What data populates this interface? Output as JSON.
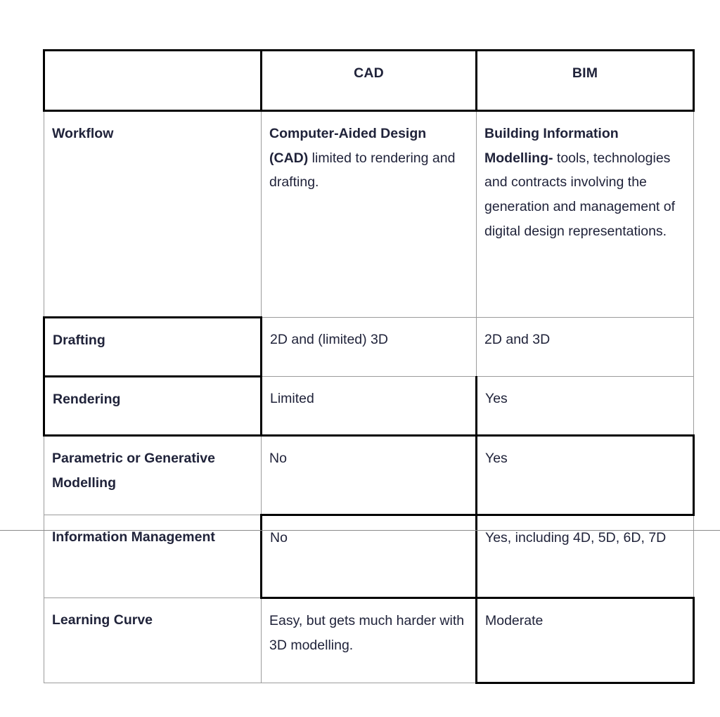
{
  "document": {
    "type": "comparison-table",
    "title_visible": false,
    "colors": {
      "header_background": "#FAE1CA",
      "text": "#20233A",
      "border_thick": "#000000",
      "border_thin": "#9B9B9B",
      "page_background": "#FFFFFF"
    },
    "page_break_rule_visible": true
  },
  "table": {
    "columns": [
      {
        "key": "criterion",
        "header": ""
      },
      {
        "key": "cad",
        "header": "CAD"
      },
      {
        "key": "bim",
        "header": "BIM"
      }
    ],
    "rows": [
      {
        "criterion": "Workflow",
        "cad_bold": "Computer-Aided Design (CAD)",
        "cad_rest": " limited to rendering and drafting.",
        "cad_full": "Computer-Aided Design (CAD) limited to rendering and drafting.",
        "bim_bold": "Building Information Modelling-",
        "bim_rest": " tools, technologies and contracts involving the generation and management of digital design representations.",
        "bim_full": "Building Information Modelling- tools, technologies and contracts involving the generation and management of digital design representations."
      },
      {
        "criterion": "Drafting",
        "cad_full": "2D and (limited) 3D",
        "bim_full": "2D and 3D"
      },
      {
        "criterion": "Rendering",
        "cad_full": "Limited",
        "bim_full": "Yes"
      },
      {
        "criterion": "Parametric or Generative Modelling",
        "cad_full": "No",
        "bim_full": "Yes"
      },
      {
        "criterion": "Information Management",
        "cad_full": "No",
        "bim_full": "Yes, including 4D, 5D, 6D, 7D"
      },
      {
        "criterion": "Learning Curve",
        "cad_full": "Easy, but gets much harder with 3D modelling.",
        "bim_full": "Moderate"
      }
    ]
  }
}
